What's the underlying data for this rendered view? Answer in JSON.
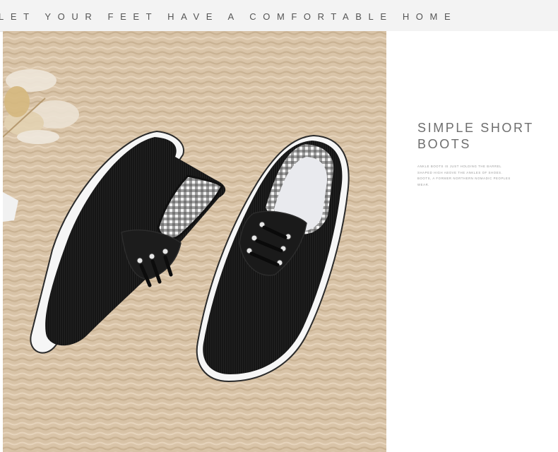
{
  "banner": {
    "text": "LET YOUR FEET HAVE A COMFORTABLE HOME"
  },
  "product": {
    "heading_line1": "SIMPLE SHORT",
    "heading_line2": "BOOTS",
    "description": "Ankle boots is just holding the barrel shaped high above the ankles of shoes. Boots, a former northern nomadic peoples wear."
  },
  "photo": {
    "subject": "black corduroy lace-up canvas shoes with white soles on woven jute mat",
    "colors": {
      "mat": "#d8c3a7",
      "shoe": "#141414",
      "sole": "#f6f6f6",
      "lining": "#3a3a3a",
      "insole": "#e9eaee"
    }
  }
}
